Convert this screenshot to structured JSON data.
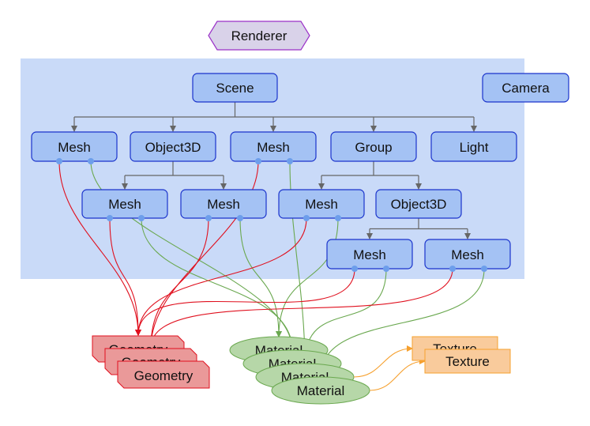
{
  "colors": {
    "scene_region": "#c9daf8",
    "node_fill": "#a4c2f4",
    "node_stroke": "#1a33cc",
    "tree_edge": "#666666",
    "port": "#6d9eeb",
    "geometry_fill": "#ea9999",
    "geometry_stroke": "#e0101e",
    "geometry_edge": "#e0101e",
    "material_fill": "#b6d7a8",
    "material_stroke": "#6aa84f",
    "material_edge": "#6aa84f",
    "texture_fill": "#f9cb9c",
    "texture_stroke": "#f6a02e",
    "texture_edge": "#f6a02e",
    "renderer_fill": "#d9d2e9",
    "renderer_stroke": "#9b31c8"
  },
  "renderer": {
    "label": "Renderer"
  },
  "nodes": {
    "scene": {
      "label": "Scene"
    },
    "camera": {
      "label": "Camera"
    },
    "mesh1": {
      "label": "Mesh"
    },
    "object1": {
      "label": "Object3D"
    },
    "mesh2": {
      "label": "Mesh"
    },
    "group": {
      "label": "Group"
    },
    "light": {
      "label": "Light"
    },
    "mesh3": {
      "label": "Mesh"
    },
    "mesh4": {
      "label": "Mesh"
    },
    "mesh5": {
      "label": "Mesh"
    },
    "object2": {
      "label": "Object3D"
    },
    "mesh6": {
      "label": "Mesh"
    },
    "mesh7": {
      "label": "Mesh"
    }
  },
  "tree_edges": [
    [
      "scene",
      [
        "mesh1",
        "object1",
        "mesh2",
        "group",
        "light"
      ]
    ],
    [
      "object1",
      [
        "mesh3",
        "mesh4"
      ]
    ],
    [
      "group",
      [
        "mesh5",
        "object2"
      ]
    ],
    [
      "object2",
      [
        "mesh6",
        "mesh7"
      ]
    ]
  ],
  "geometries": [
    {
      "label": "Geometry"
    },
    {
      "label": "Geometry"
    },
    {
      "label": "Geometry"
    }
  ],
  "materials": [
    {
      "label": "Material"
    },
    {
      "label": "Material"
    },
    {
      "label": "Material"
    },
    {
      "label": "Material"
    }
  ],
  "textures": [
    {
      "label": "Texture"
    },
    {
      "label": "Texture"
    }
  ],
  "mesh_links": [
    {
      "mesh": "mesh1",
      "geometry": 0,
      "material": 1
    },
    {
      "mesh": "mesh2",
      "geometry": 1,
      "material": 2
    },
    {
      "mesh": "mesh3",
      "geometry": 0,
      "material": 1
    },
    {
      "mesh": "mesh4",
      "geometry": 1,
      "material": 0
    },
    {
      "mesh": "mesh5",
      "geometry": 0,
      "material": 0
    },
    {
      "mesh": "mesh6",
      "geometry": 0,
      "material": 2
    },
    {
      "mesh": "mesh7",
      "geometry": 1,
      "material": 3
    }
  ],
  "material_texture_links": [
    {
      "material": 2,
      "texture": 0
    },
    {
      "material": 3,
      "texture": 1
    }
  ]
}
